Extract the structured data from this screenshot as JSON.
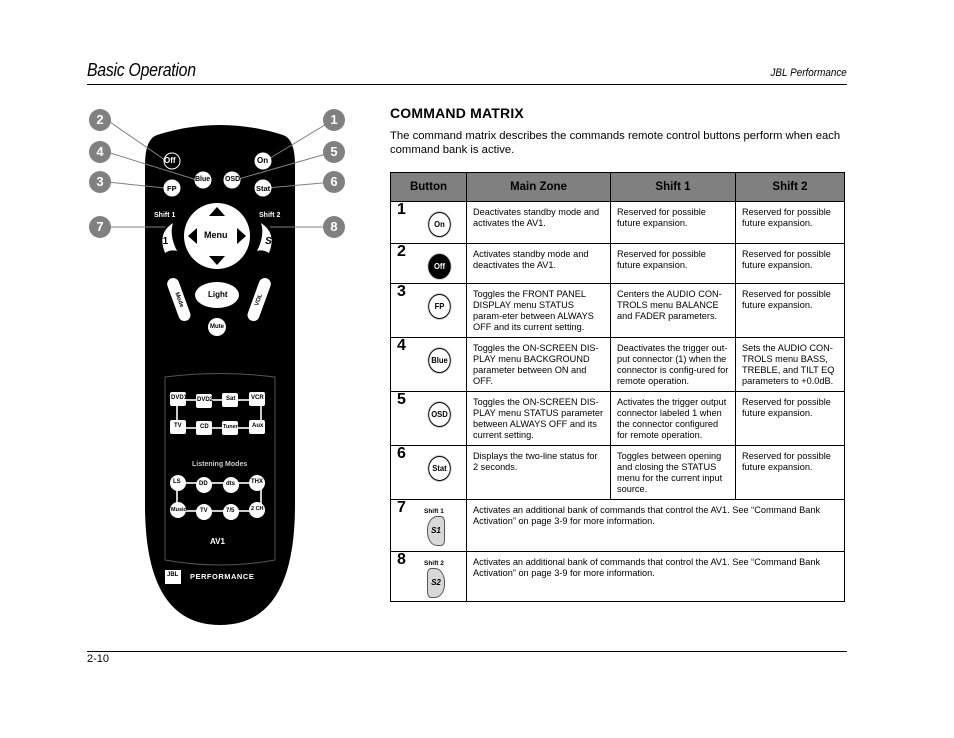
{
  "header": {
    "title": "Basic Operation",
    "product": "JBL Performance"
  },
  "footer": {
    "page_number": "2-10"
  },
  "section": {
    "title": "COMMAND MATRIX",
    "intro": "The command matrix describes the commands remote control buttons perform when each command bank is active."
  },
  "remote": {
    "callouts": [
      "1",
      "2",
      "3",
      "4",
      "5",
      "6",
      "7",
      "8"
    ],
    "buttons": {
      "off": "Off",
      "on": "On",
      "blue": "Blue",
      "osd": "OSD",
      "fp": "FP",
      "stat": "Stat",
      "shift1_label": "Shift 1",
      "shift2_label": "Shift 2",
      "s1": "S1",
      "s2": "S2",
      "menu": "Menu",
      "light": "Light",
      "mute": "Mute",
      "mode": "Mode",
      "vol": "VOL"
    },
    "sources": [
      "DVD1",
      "DVD2",
      "Sat",
      "VCR",
      "TV",
      "CD",
      "Tuner",
      "Aux"
    ],
    "listening_modes_label": "Listening Modes",
    "modes": [
      "LS",
      "DD",
      "dts",
      "THX",
      "Music",
      "TV",
      "7/5",
      "2 CH"
    ],
    "zone": "AV1",
    "brand": "JBL",
    "brand_line": "PERFORMANCE"
  },
  "table": {
    "headers": [
      "Button",
      "Main Zone",
      "Shift 1",
      "Shift 2"
    ],
    "rows": [
      {
        "num": "1",
        "button": "On",
        "main": "Deactivates standby mode and activates the AV1.",
        "shift1": "Reserved for possible future expansion.",
        "shift2": "Reserved for possible future expansion."
      },
      {
        "num": "2",
        "button": "Off",
        "main": "Activates standby mode and deactivates the AV1.",
        "shift1": "Reserved for possible future expansion.",
        "shift2": "Reserved for possible future expansion."
      },
      {
        "num": "3",
        "button": "FP",
        "main": "Toggles the FRONT PANEL DISPLAY menu STATUS param-eter between ALWAYS OFF and its current setting.",
        "shift1": "Centers the AUDIO CON-TROLS menu BALANCE and FADER parameters.",
        "shift2": "Reserved for possible future expansion."
      },
      {
        "num": "4",
        "button": "Blue",
        "main": "Toggles the ON-SCREEN DIS-PLAY menu BACKGROUND parameter between ON and OFF.",
        "shift1": "Deactivates the trigger out-put connector (1) when the connector is config-ured for remote operation.",
        "shift2": "Sets the AUDIO CON-TROLS menu BASS, TREBLE, and TILT EQ parameters to +0.0dB."
      },
      {
        "num": "5",
        "button": "OSD",
        "main": "Toggles the ON-SCREEN DIS-PLAY menu STATUS parameter between ALWAYS OFF and its current setting.",
        "shift1": "Activates the trigger output connector labeled 1 when the connector configured for remote operation.",
        "shift2": "Reserved for possible future expansion."
      },
      {
        "num": "6",
        "button": "Stat",
        "main": "Displays the two-line status for 2 seconds.",
        "shift1": "Toggles between opening and closing the STATUS menu for the current input source.",
        "shift2": "Reserved for possible future expansion."
      },
      {
        "num": "7",
        "button_label": "Shift 1",
        "button": "S1",
        "span_text": "Activates an additional bank of commands that control the AV1. See “Command Bank Activation” on page 3-9 for more information."
      },
      {
        "num": "8",
        "button_label": "Shift 2",
        "button": "S2",
        "span_text": "Activates an additional bank of commands that control the AV1. See “Command Bank Activation” on page 3-9 for more information."
      }
    ]
  }
}
